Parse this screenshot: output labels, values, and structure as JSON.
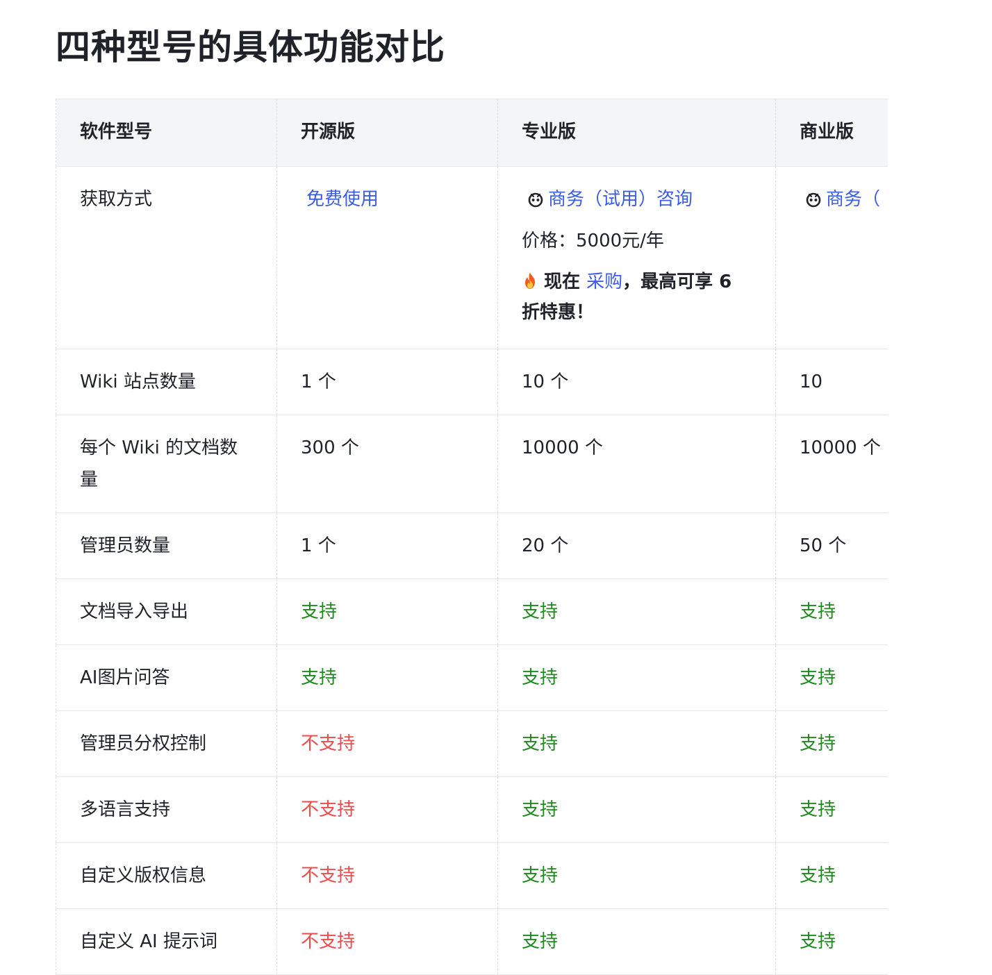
{
  "page": {
    "title": "四种型号的具体功能对比"
  },
  "table": {
    "headers": [
      "软件型号",
      "开源版",
      "专业版",
      "商业版"
    ],
    "access": {
      "label": "获取方式",
      "open_source_link": "免费使用",
      "pro_link": "商务（试用）咨询",
      "pro_price": "价格：5000元/年",
      "promo_prefix": "现在",
      "promo_link": "采购",
      "promo_suffix": "，最高可享 6 折特惠！",
      "business_link": "商务（"
    },
    "rows": [
      {
        "feature": "Wiki 站点数量",
        "open": "1 个",
        "pro": "10 个",
        "business": "10"
      },
      {
        "feature": "每个 Wiki 的文档数量",
        "open": "300 个",
        "pro": "10000 个",
        "business": "10000 个"
      },
      {
        "feature": "管理员数量",
        "open": "1 个",
        "pro": "20 个",
        "business": "50 个"
      },
      {
        "feature": "文档导入导出",
        "open": "支持",
        "pro": "支持",
        "business": "支持"
      },
      {
        "feature": "AI图片问答",
        "open": "支持",
        "pro": "支持",
        "business": "支持"
      },
      {
        "feature": "管理员分权控制",
        "open": "不支持",
        "pro": "支持",
        "business": "支持"
      },
      {
        "feature": "多语言支持",
        "open": "不支持",
        "pro": "支持",
        "business": "支持"
      },
      {
        "feature": "自定义版权信息",
        "open": "不支持",
        "pro": "支持",
        "business": "支持"
      },
      {
        "feature": "自定义 AI 提示词",
        "open": "不支持",
        "pro": "支持",
        "business": "支持"
      }
    ]
  },
  "colors": {
    "link": "#3b5ce9",
    "supported": "#1e8a1e",
    "unsupported": "#ef4b4b",
    "header_bg": "#f4f5f6"
  },
  "icons": {
    "consult": "consult-bot-icon",
    "promo": "fire-icon"
  }
}
